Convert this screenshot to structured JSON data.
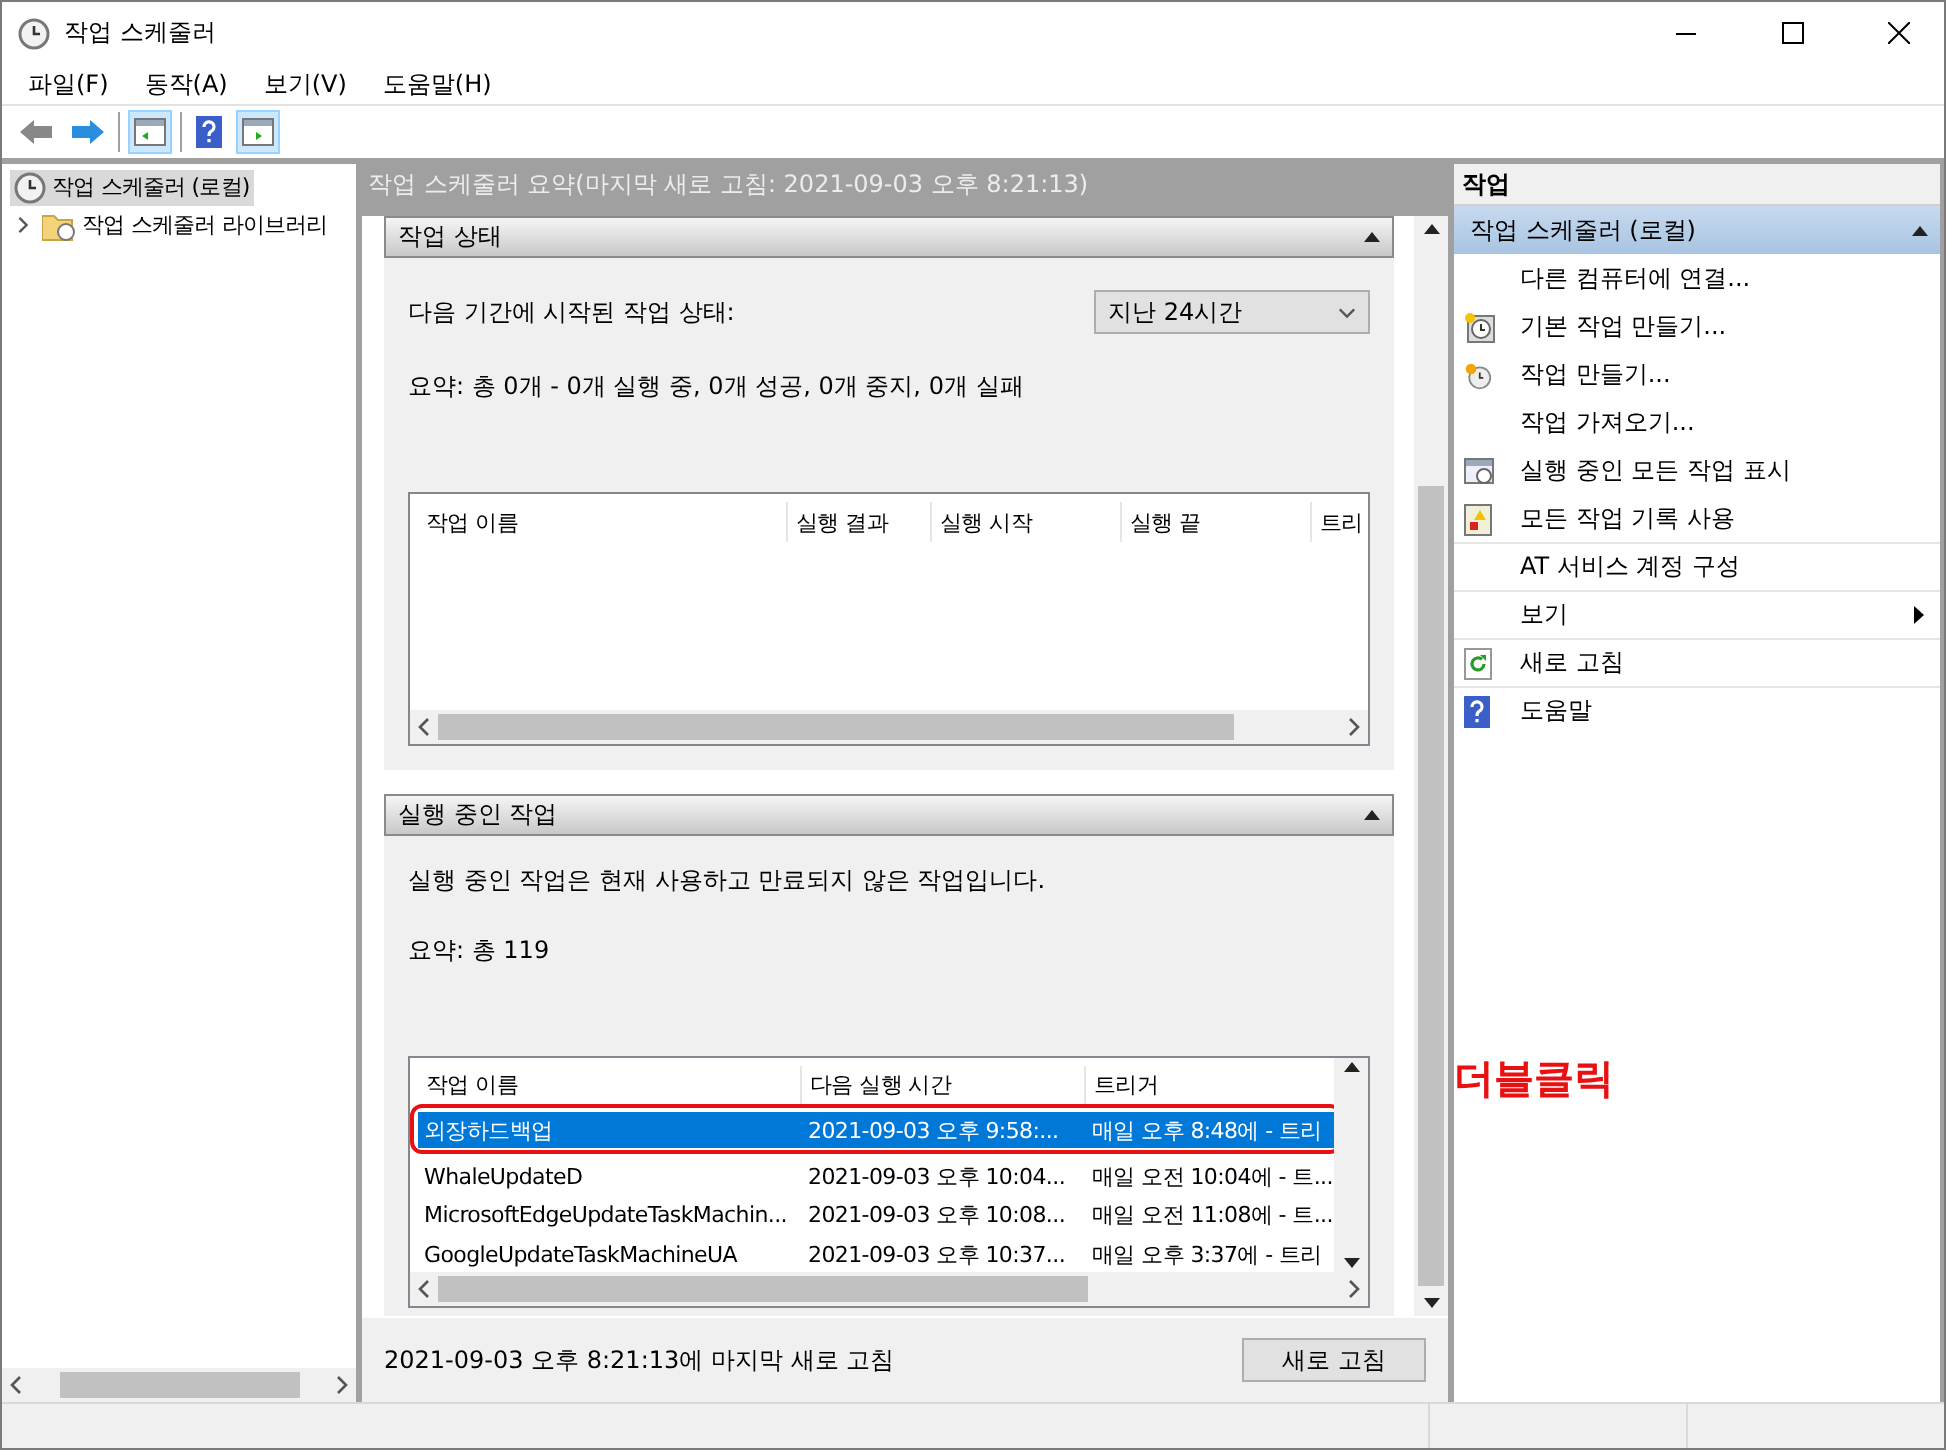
{
  "window": {
    "title": "작업 스케줄러"
  },
  "menu": [
    "파일(F)",
    "동작(A)",
    "보기(V)",
    "도움말(H)"
  ],
  "tree": [
    {
      "label": "작업 스케줄러 (로컬)",
      "selected": true,
      "children": [
        {
          "label": "작업 스케줄러 라이브러리",
          "selected": false,
          "expanded": false
        }
      ]
    }
  ],
  "summary_header": "작업 스케줄러 요약(마지막 새로 고침: 2021-09-03 오후 8:21:13)",
  "status_section": {
    "title": "작업 상태",
    "expanded": true,
    "period_label": "다음 기간에 시작된 작업 상태:",
    "period_value": "지난 24시간",
    "summary": "요약: 총 0개 - 0개 실행 중, 0개 성공, 0개 중지, 0개 실패",
    "columns": [
      "작업 이름",
      "실행 결과",
      "실행 시작",
      "실행 끝",
      "트리"
    ]
  },
  "running_section": {
    "title": "실행 중인 작업",
    "expanded": true,
    "description": "실행 중인 작업은 현재 사용하고 만료되지 않은 작업입니다.",
    "summary": "요약: 총 119",
    "columns": [
      "작업 이름",
      "다음 실행 시간",
      "트리거"
    ],
    "rows": [
      {
        "cells": [
          "외장하드백업",
          "2021-09-03 오후 9:58:...",
          "매일 오후 8:48에 - 트리"
        ],
        "selected": true
      },
      {
        "cells": [
          "WhaleUpdateD",
          "2021-09-03 오후 10:04...",
          "매일 오전 10:04에 - 트..."
        ],
        "selected": false
      },
      {
        "cells": [
          "MicrosoftEdgeUpdateTaskMachin...",
          "2021-09-03 오후 10:08...",
          "매일 오전 11:08에 - 트..."
        ],
        "selected": false
      },
      {
        "cells": [
          "GoogleUpdateTaskMachineUA",
          "2021-09-03 오후 10:37...",
          "매일 오후 3:37에 - 트리"
        ],
        "selected": false
      }
    ]
  },
  "footer": {
    "refresh_text": "2021-09-03 오후 8:21:13에 마지막 새로 고침",
    "button": "새로 고침"
  },
  "annotation": {
    "text": "더블클릭"
  },
  "actions": {
    "header": "작업",
    "group": {
      "title": "작업 스케줄러 (로컬)",
      "expanded": true
    },
    "items": [
      {
        "label": "다른 컴퓨터에 연결...",
        "kind": "plain"
      },
      {
        "label": "기본 작업 만들기...",
        "kind": "wizard"
      },
      {
        "label": "작업 만들기...",
        "kind": "create"
      },
      {
        "label": "작업 가져오기...",
        "kind": "plain"
      },
      {
        "label": "실행 중인 모든 작업 표시",
        "kind": "running"
      },
      {
        "label": "모든 작업 기록 사용",
        "kind": "history"
      },
      {
        "label": "AT 서비스 계정 구성",
        "kind": "plain"
      },
      {
        "label": "보기",
        "kind": "submenu"
      },
      {
        "label": "새로 고침",
        "kind": "refresh"
      },
      {
        "label": "도움말",
        "kind": "help"
      }
    ]
  }
}
